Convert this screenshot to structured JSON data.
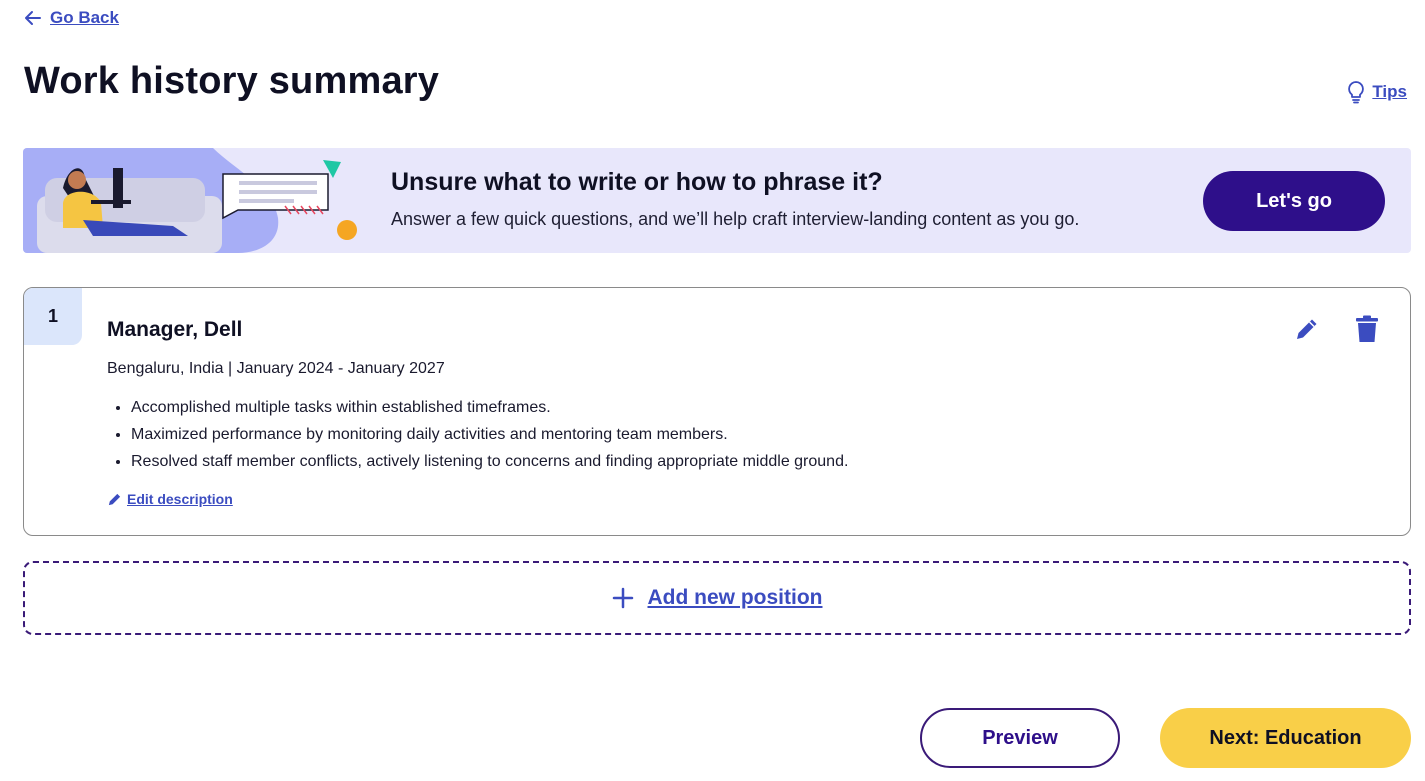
{
  "nav": {
    "go_back_label": "Go Back",
    "go_back_icon": "arrow-left-icon"
  },
  "header": {
    "title": "Work history summary",
    "tips_label": "Tips",
    "tips_icon": "lightbulb-icon"
  },
  "banner": {
    "heading": "Unsure what to write or how to phrase it?",
    "subtext": "Answer a few quick questions, and we’ll help craft interview-landing content as you go.",
    "cta_label": "Let's go",
    "illustration": "person-on-couch-with-laptop-illustration"
  },
  "positions": [
    {
      "number": "1",
      "title": "Manager, Dell",
      "meta": "Bengaluru, India | January 2024 - January 2027",
      "bullets": [
        "Accomplished multiple tasks within established timeframes.",
        "Maximized performance by monitoring daily activities and mentoring team members.",
        "Resolved staff member conflicts, actively listening to concerns and finding appropriate middle ground."
      ],
      "edit_description_label": "Edit description",
      "edit_icon": "pencil-icon",
      "delete_icon": "trash-icon"
    }
  ],
  "add_position": {
    "label": "Add new position",
    "icon": "plus-icon"
  },
  "footer": {
    "preview_label": "Preview",
    "next_label": "Next: Education"
  },
  "colors": {
    "link": "#3b4cc0",
    "primary_dark": "#2e0f8a",
    "banner_bg": "#e8e7fb",
    "number_badge_bg": "#dbe6fb",
    "next_button_bg": "#f9cf48",
    "dashed_border": "#3a1a78"
  }
}
